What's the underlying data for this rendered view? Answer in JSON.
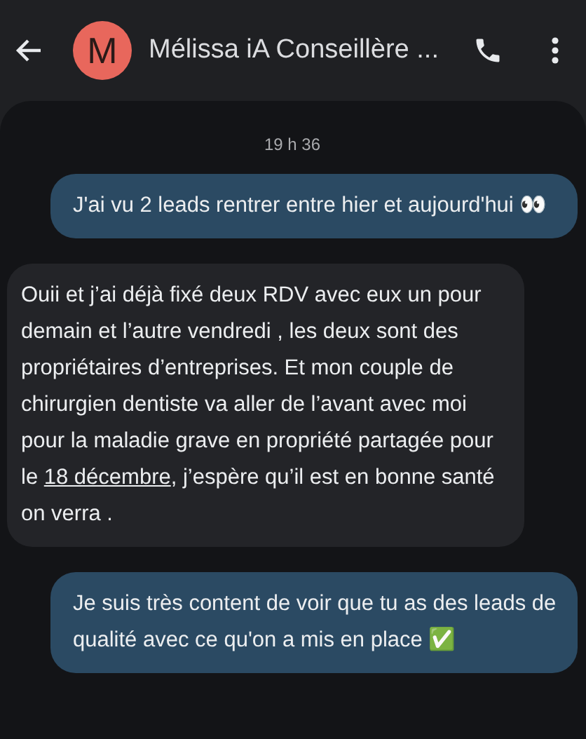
{
  "header": {
    "avatar_letter": "M",
    "title": "Mélissa iA Conseillère ..."
  },
  "timestamp": "19 h 36",
  "messages": [
    {
      "kind": "outgoing",
      "parts": [
        {
          "kind": "text",
          "text": "J'ai vu 2 leads rentrer entre hier et aujourd'hui 👀"
        }
      ]
    },
    {
      "kind": "incoming",
      "parts": [
        {
          "kind": "text",
          "text": "Ouii et j’ai déjà fixé deux RDV avec eux  un pour demain et l’autre vendredi , les deux sont des propriétaires d’entreprises. Et mon couple de chirurgien dentiste va aller de l’avant avec moi pour la maladie grave en propriété partagée pour le "
        },
        {
          "kind": "link",
          "text": "18 décembre"
        },
        {
          "kind": "text",
          "text": ", j’espère qu’il est en bonne santé on verra ."
        }
      ]
    },
    {
      "kind": "outgoing",
      "parts": [
        {
          "kind": "text",
          "text": "Je suis très content de voir que tu as des leads de qualité avec ce qu'on a mis en place ✅"
        }
      ]
    }
  ]
}
